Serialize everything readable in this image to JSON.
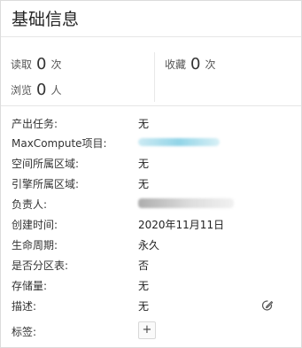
{
  "panel": {
    "title": "基础信息"
  },
  "stats": {
    "read": {
      "label": "读取",
      "value": "0",
      "unit": "次"
    },
    "view": {
      "label": "浏览",
      "value": "0",
      "unit": "人"
    },
    "favorite": {
      "label": "收藏",
      "value": "0",
      "unit": "次"
    }
  },
  "details": {
    "output_task": {
      "label": "产出任务:",
      "value": "无"
    },
    "maxcompute": {
      "label": "MaxCompute项目:",
      "value_redacted": true
    },
    "space_region": {
      "label": "空间所属区域:",
      "value": "无"
    },
    "engine_region": {
      "label": "引擎所属区域:",
      "value": "无"
    },
    "owner": {
      "label": "负责人:",
      "value_redacted": true
    },
    "created": {
      "label": "创建时间:",
      "value": "2020年11月11日"
    },
    "lifecycle": {
      "label": "生命周期:",
      "value": "永久"
    },
    "partitioned": {
      "label": "是否分区表:",
      "value": "否"
    },
    "storage": {
      "label": "存储量:",
      "value": "无"
    },
    "description": {
      "label": "描述:",
      "value": "无",
      "edit_icon": "edit-icon"
    },
    "tags": {
      "label": "标签:",
      "add_label": "+"
    }
  }
}
